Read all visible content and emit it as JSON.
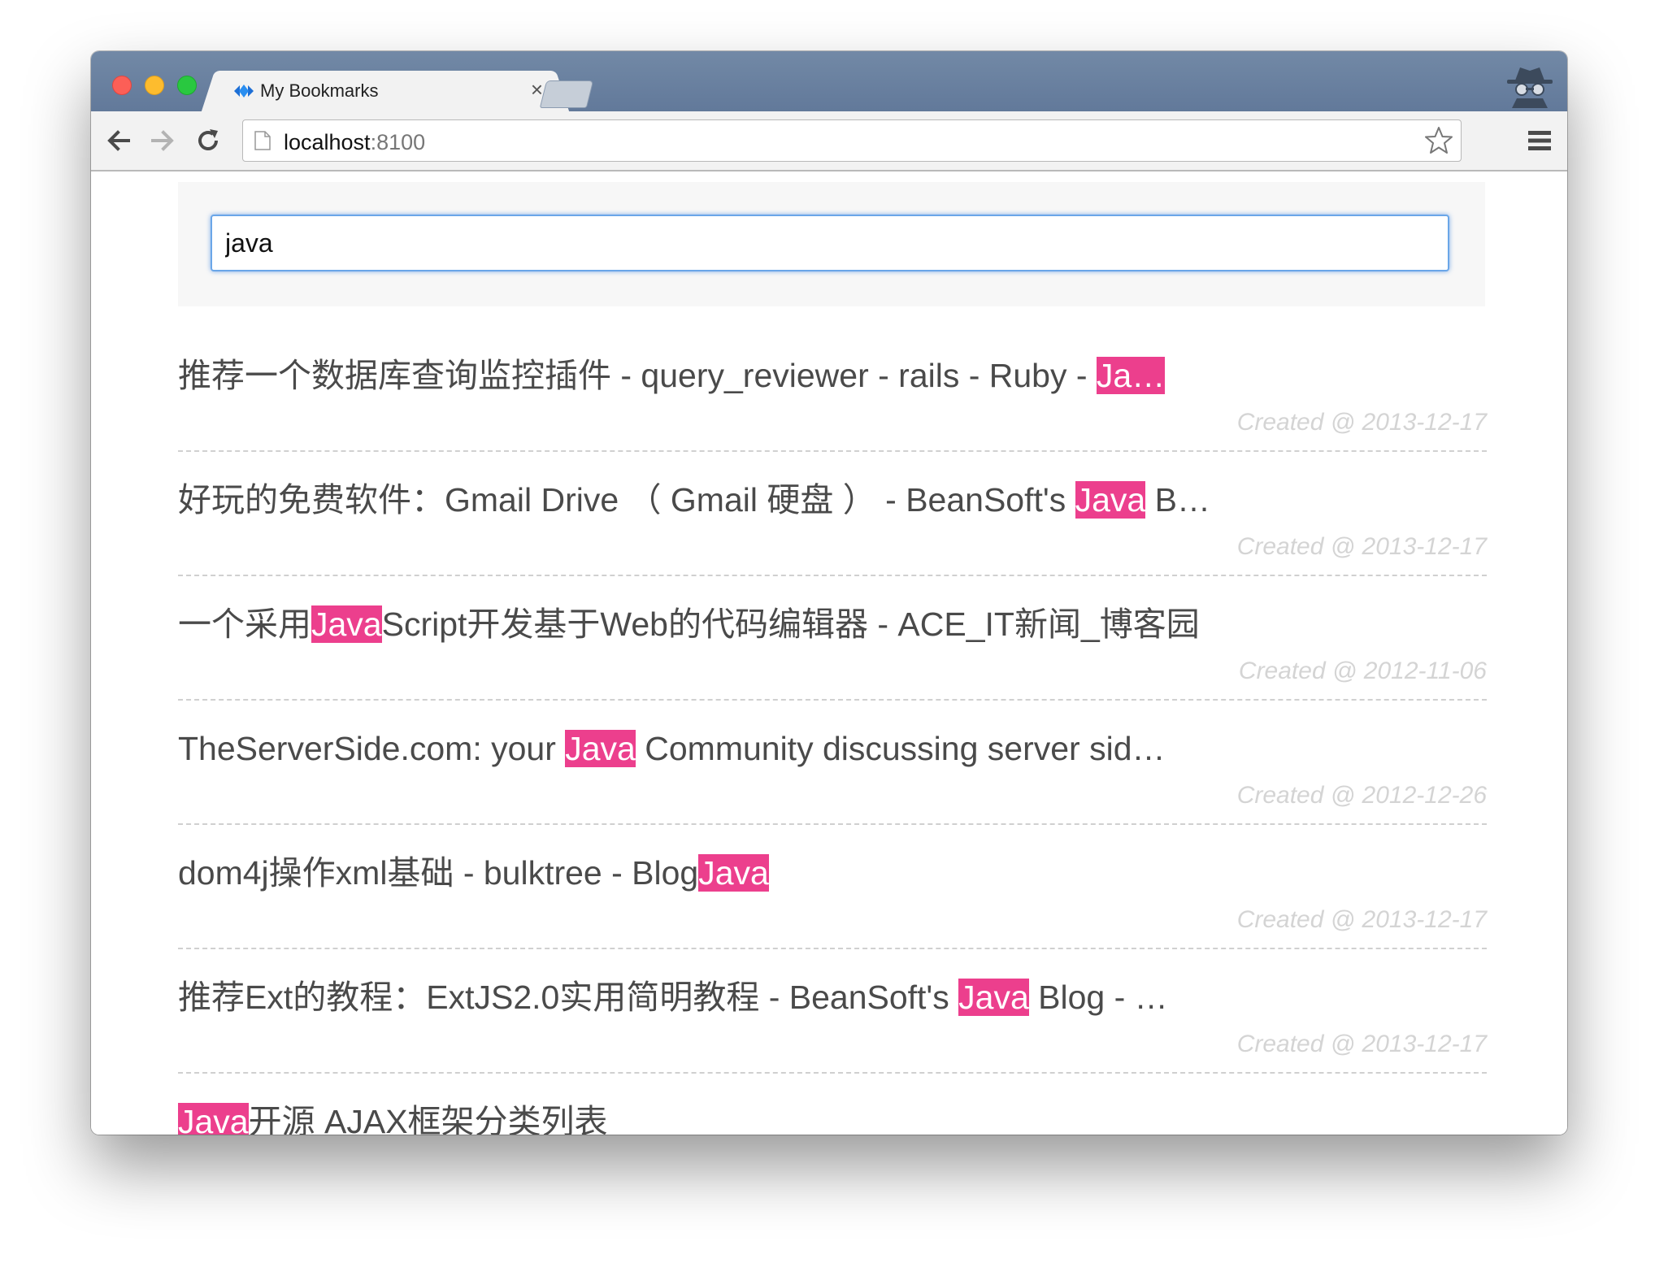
{
  "browser": {
    "tab_title": "My Bookmarks",
    "tab_close": "×",
    "url_host": "localhost",
    "url_port": ":8100",
    "icons": {
      "favicon": "bookmarks-diamond-icon",
      "back": "back-arrow-icon",
      "forward": "forward-arrow-icon",
      "reload": "reload-icon",
      "page": "page-icon",
      "star": "star-icon",
      "menu": "hamburger-menu-icon",
      "incognito": "incognito-icon"
    },
    "colors": {
      "titlebar": "#6d84a1",
      "toolbar": "#f2f2f2"
    }
  },
  "search": {
    "value": "java"
  },
  "highlight_color": "#ec3f8d",
  "results": [
    {
      "pre": "推荐一个数据库查询监控插件 - query_reviewer - rails - Ruby - ",
      "match": "Ja…",
      "post": "",
      "date": "Created @ 2013-12-17"
    },
    {
      "pre": "好玩的免费软件：Gmail Drive （ Gmail 硬盘 ） - BeanSoft's ",
      "match": "Java",
      "post": " B…",
      "date": "Created @ 2013-12-17"
    },
    {
      "pre": "一个采用",
      "match": "Java",
      "post": "Script开发基于Web的代码编辑器 - ACE_IT新闻_博客园",
      "date": "Created @ 2012-11-06"
    },
    {
      "pre": "TheServerSide.com: your ",
      "match": "Java",
      "post": " Community discussing server sid…",
      "date": "Created @ 2012-12-26"
    },
    {
      "pre": "dom4j操作xml基础 - bulktree - Blog",
      "match": "Java",
      "post": "",
      "date": "Created @ 2013-12-17"
    },
    {
      "pre": "推荐Ext的教程：ExtJS2.0实用简明教程 - BeanSoft's ",
      "match": "Java",
      "post": " Blog - …",
      "date": "Created @ 2013-12-17"
    },
    {
      "pre": "",
      "match": "Java",
      "post": "开源 AJAX框架分类列表",
      "date": ""
    }
  ]
}
